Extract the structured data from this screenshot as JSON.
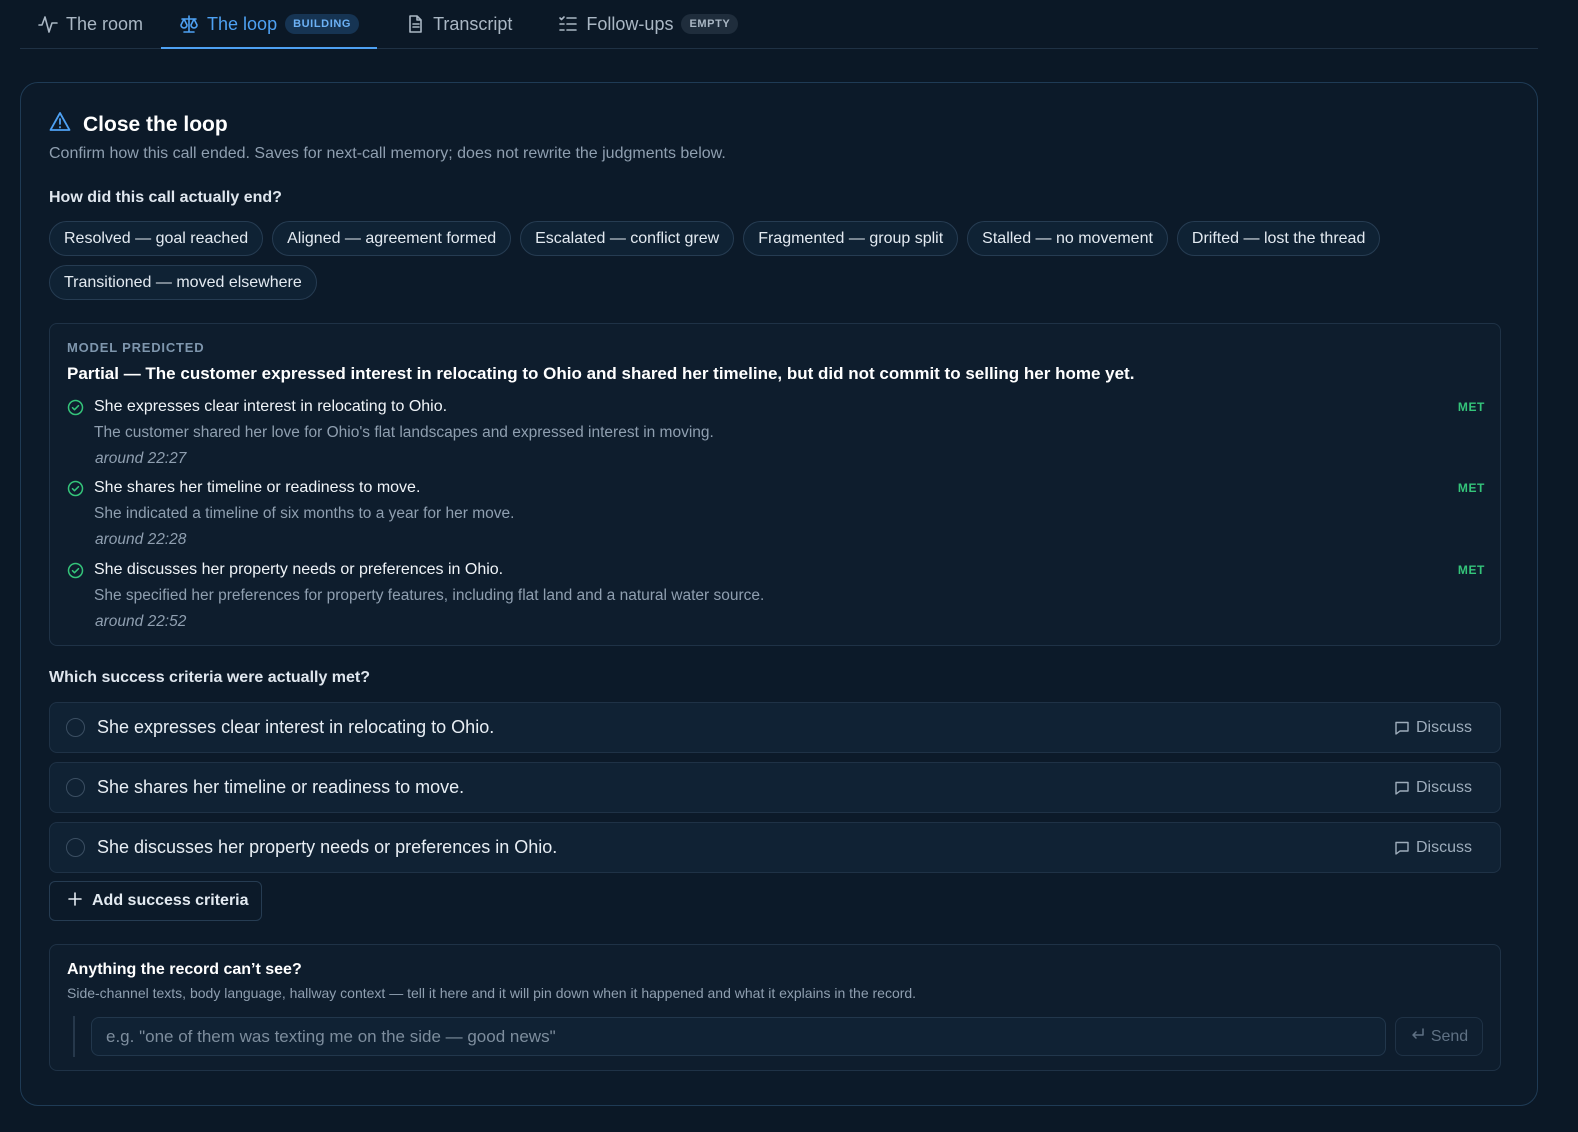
{
  "tabs": [
    {
      "label": "The room",
      "icon": "activity-icon",
      "badge": ""
    },
    {
      "label": "The loop",
      "icon": "scale-icon",
      "badge": "BUILDING"
    },
    {
      "label": "Transcript",
      "icon": "document-icon",
      "badge": ""
    },
    {
      "label": "Follow-ups",
      "icon": "checklist-icon",
      "badge": "EMPTY"
    }
  ],
  "card": {
    "title": "Close the loop",
    "subtitle": "Confirm how this call ended. Saves for next-call memory; does not rewrite the judgments below.",
    "outcome_question": "How did this call actually end?",
    "outcomes": [
      "Resolved — goal reached",
      "Aligned — agreement formed",
      "Escalated — conflict grew",
      "Fragmented — group split",
      "Stalled — no movement",
      "Drifted — lost the thread",
      "Transitioned — moved elsewhere"
    ],
    "prediction": {
      "label": "MODEL PREDICTED",
      "headline": "Partial — The customer expressed interest in relocating to Ohio and shared her timeline, but did not commit to selling her home yet.",
      "criteria": [
        {
          "text": "She expresses clear interest in relocating to Ohio.",
          "status": "MET",
          "detail": "The customer shared her love for Ohio's flat landscapes and expressed interest in moving.",
          "time": "around 22:27"
        },
        {
          "text": "She shares her timeline or readiness to move.",
          "status": "MET",
          "detail": "She indicated a timeline of six months to a year for her move.",
          "time": "around 22:28"
        },
        {
          "text": "She discusses her property needs or preferences in Ohio.",
          "status": "MET",
          "detail": "She specified her preferences for property features, including flat land and a natural water source.",
          "time": "around 22:52"
        }
      ]
    },
    "success_question": "Which success criteria were actually met?",
    "success_criteria": [
      "She expresses clear interest in relocating to Ohio.",
      "She shares her timeline or readiness to move.",
      "She discusses her property needs or preferences in Ohio."
    ],
    "discuss_label": "Discuss",
    "add_label": "Add success criteria",
    "record": {
      "heading": "Anything the record can’t see?",
      "subtext": "Side-channel texts, body language, hallway context — tell it here and it will pin down when it happened and what it explains in the record.",
      "placeholder": "e.g. \"one of them was texting me on the side — good news\"",
      "send_label": "Send"
    }
  },
  "colors": {
    "accent": "#4ea1f3",
    "met": "#34c47a",
    "background": "#0b1826"
  }
}
